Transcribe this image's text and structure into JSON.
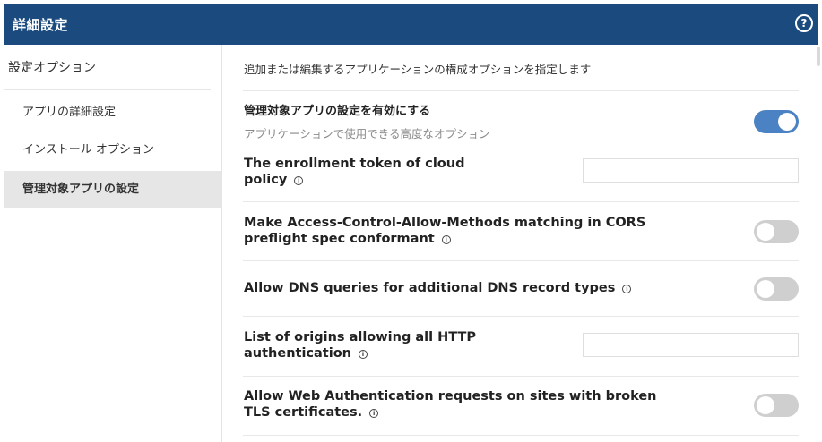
{
  "header": {
    "title": "詳細設定",
    "help_icon": "question-circle-icon"
  },
  "sidebar": {
    "heading": "設定オプション",
    "items": [
      {
        "label": "アプリの詳細設定",
        "active": false
      },
      {
        "label": "インストール オプション",
        "active": false
      },
      {
        "label": "管理対象アプリの設定",
        "active": true
      }
    ]
  },
  "main": {
    "description": "追加または編集するアプリケーションの構成オプションを指定します",
    "settings": [
      {
        "title": "管理対象アプリの設定を有効にする",
        "subtitle": "アプリケーションで使用できる高度なオプション",
        "control": "toggle",
        "enabled": true
      },
      {
        "title_line1": "The enrollment token of cloud",
        "title_line2": "policy",
        "control": "text",
        "value": ""
      },
      {
        "title_line1": "Make Access-Control-Allow-Methods matching in CORS",
        "title_line2": "preflight spec conformant",
        "control": "toggle",
        "enabled": false
      },
      {
        "title": "Allow DNS queries for additional DNS record types",
        "control": "toggle",
        "enabled": false
      },
      {
        "title_line1": "List of origins allowing all HTTP",
        "title_line2": "authentication",
        "control": "text",
        "value": ""
      },
      {
        "title_line1": "Allow Web Authentication requests on sites with broken",
        "title_line2": "TLS certificates.",
        "control": "toggle",
        "enabled": false
      }
    ]
  },
  "colors": {
    "header_bg": "#1b4a7e",
    "toggle_on": "#4a82c3",
    "toggle_off": "#cfcfcf",
    "active_item_bg": "#e6e6e6"
  }
}
